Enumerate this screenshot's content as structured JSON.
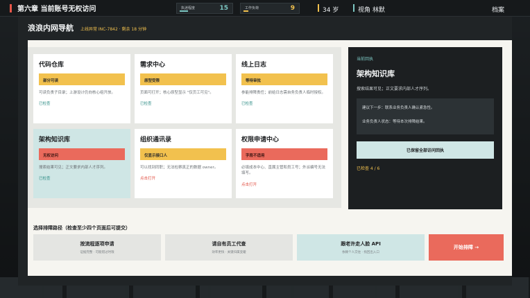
{
  "hud": {
    "chapter": "第六章  当前账号无权访问",
    "stats": [
      {
        "label": "执迷程度",
        "value": "15",
        "color": "#7cc7c2",
        "fill": 0.15
      },
      {
        "label": "工作负荷",
        "value": "9",
        "color": "#f2c14e",
        "fill": 0.09
      }
    ],
    "age": "34 岁",
    "view": "视角  林默",
    "archive": "档案"
  },
  "window": {
    "title": "浪浪内网导航",
    "subtitle": "上线异常 INC-7842 · 剩余 18 分钟"
  },
  "cards": [
    {
      "title": "代码仓库",
      "tag": "部分可读",
      "tag_color": "yellow",
      "desc": "可读负责子目录；上游设计仍向核心组开放。",
      "status": "已检查",
      "status_type": "checked"
    },
    {
      "title": "需求中心",
      "tag": "原型受限",
      "tag_color": "yellow",
      "desc": "页面可打开；核心原型显示 \"仅页工可见\"。",
      "status": "已检查",
      "status_type": "checked"
    },
    {
      "title": "线上日志",
      "tag": "等待审批",
      "tag_color": "yellow",
      "desc": "参能排障责任；前给日志需自务负责人临时授权。",
      "status": "已检查",
      "status_type": "checked"
    },
    {
      "title": "架构知识库",
      "tag": "无权访问",
      "tag_color": "red",
      "desc": "搜索结果可见；正文要求内部人才序列。",
      "status": "已检查",
      "status_type": "checked",
      "active": true
    },
    {
      "title": "组织通讯录",
      "tag": "仅显示接口人",
      "tag_color": "yellow",
      "desc": "可以找到同职；无法检察真正的数据 owner。",
      "status": "点击打开",
      "status_type": "open"
    },
    {
      "title": "权限申请中心",
      "tag": "字段不适用",
      "tag_color": "red",
      "desc": "必填成本中心、直属主管和员工号；外派编号无法填写。",
      "status": "点击打开",
      "status_type": "open"
    }
  ],
  "result": {
    "label": "当前回执",
    "title": "架构知识库",
    "text": "搜索结果可见；正文要求内部人才序列。",
    "box_lines": [
      "建议下一步：联系业务负责人确认紧急性。",
      "业务负责人状态：等待本次排障结果。"
    ],
    "button": "已保留全部访问回执",
    "count": "已检查 4 / 6"
  },
  "paths": {
    "title": "选择排障路径（检查至少四个页面后可提交）",
    "routes": [
      {
        "name": "按流程逐项申请",
        "sub": "证据完整 · 可能错过时限",
        "style": "gray"
      },
      {
        "name": "请自有员工代查",
        "sub": "效率更快 · 关键归属变暧",
        "style": "gray"
      },
      {
        "name": "跟老许走人脸 API",
        "sub": "依赖个人交往 · 找回出入口",
        "style": "teal"
      },
      {
        "name": "开始排障 →",
        "sub": "",
        "style": "start"
      }
    ]
  }
}
